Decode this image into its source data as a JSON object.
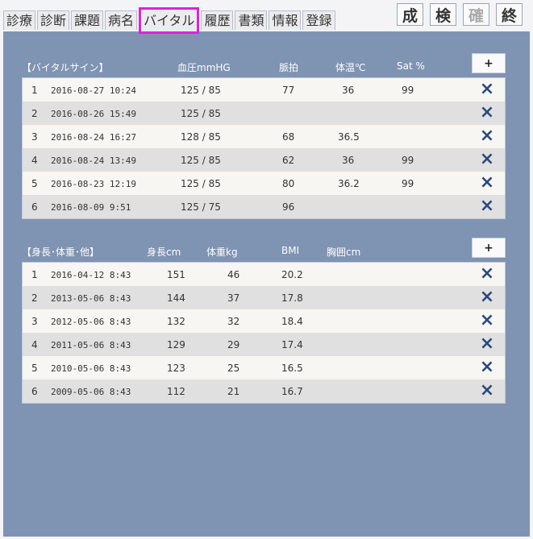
{
  "tabs": [
    "診療",
    "診断",
    "課題",
    "病名",
    "バイタル",
    "履歴",
    "書類",
    "情報",
    "登録"
  ],
  "active_tab": "バイタル",
  "actions": [
    "成",
    "検",
    "確",
    "終"
  ],
  "vitals": {
    "title": "【バイタルサイン】",
    "col_bp": "血圧mmHG",
    "col_pulse": "脈拍",
    "col_temp": "体温℃",
    "col_sat": "Sat %",
    "add_label": "+",
    "rows": [
      {
        "no": "1",
        "date": "2016-08-27 10:24",
        "bp": "125 / 85",
        "pulse": "77",
        "temp": "36",
        "sat": "99"
      },
      {
        "no": "2",
        "date": "2016-08-26 15:49",
        "bp": "125 / 85",
        "pulse": "",
        "temp": "",
        "sat": ""
      },
      {
        "no": "3",
        "date": "2016-08-24 16:27",
        "bp": "128 / 85",
        "pulse": "68",
        "temp": "36.5",
        "sat": ""
      },
      {
        "no": "4",
        "date": "2016-08-24 13:49",
        "bp": "125 / 85",
        "pulse": "62",
        "temp": "36",
        "sat": "99"
      },
      {
        "no": "5",
        "date": "2016-08-23 12:19",
        "bp": "125 / 85",
        "pulse": "80",
        "temp": "36.2",
        "sat": "99"
      },
      {
        "no": "6",
        "date": "2016-08-09 9:51",
        "bp": "125 / 75",
        "pulse": "96",
        "temp": "",
        "sat": ""
      }
    ]
  },
  "body": {
    "title": "【身長･体重･他】",
    "col_height": "身長cm",
    "col_weight": "体重kg",
    "col_bmi": "BMI",
    "col_chest": "胸囲cm",
    "add_label": "+",
    "rows": [
      {
        "no": "1",
        "date": "2016-04-12 8:43",
        "height": "151",
        "weight": "46",
        "bmi": "20.2",
        "chest": ""
      },
      {
        "no": "2",
        "date": "2013-05-06 8:43",
        "height": "144",
        "weight": "37",
        "bmi": "17.8",
        "chest": ""
      },
      {
        "no": "3",
        "date": "2012-05-06 8:43",
        "height": "132",
        "weight": "32",
        "bmi": "18.4",
        "chest": ""
      },
      {
        "no": "4",
        "date": "2011-05-06 8:43",
        "height": "129",
        "weight": "29",
        "bmi": "17.4",
        "chest": ""
      },
      {
        "no": "5",
        "date": "2010-05-06 8:43",
        "height": "123",
        "weight": "25",
        "bmi": "16.5",
        "chest": ""
      },
      {
        "no": "6",
        "date": "2009-05-06 8:43",
        "height": "112",
        "weight": "21",
        "bmi": "16.7",
        "chest": ""
      }
    ]
  },
  "delete_icon": "×",
  "colors": {
    "background": "#7f93b2",
    "active_tab_border": "#e21ee0",
    "delete_icon": "#2a4a7c"
  }
}
